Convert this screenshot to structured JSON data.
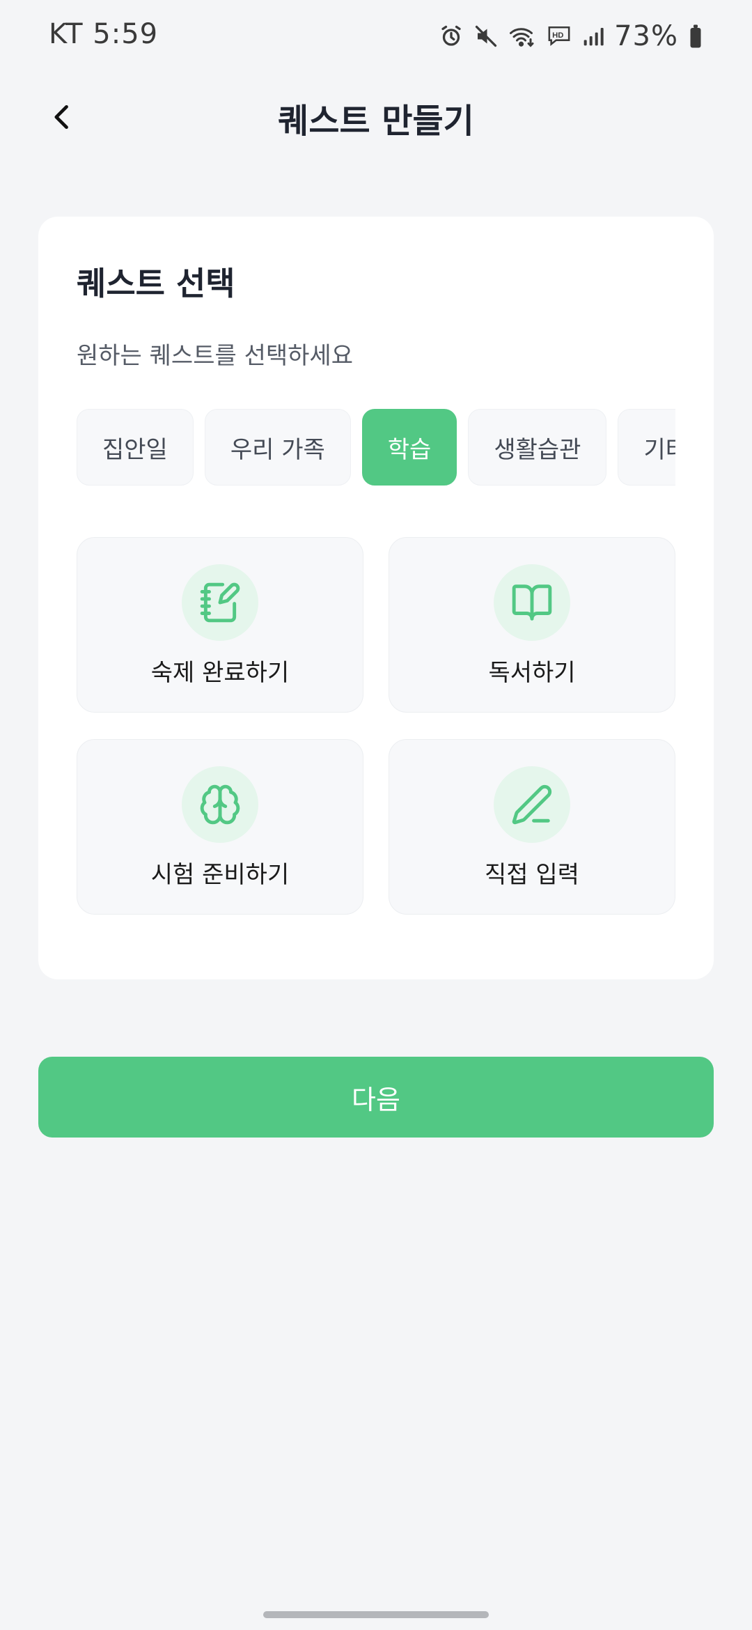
{
  "status_bar": {
    "carrier_time": "KT 5:59",
    "battery_percent": "73%",
    "icons": [
      "alarm-icon",
      "mute-icon",
      "wifi-icon",
      "hd-voice-icon",
      "signal-icon",
      "battery-icon"
    ]
  },
  "header": {
    "back_icon": "chevron-left-icon",
    "title": "퀘스트 만들기"
  },
  "card": {
    "title": "퀘스트 선택",
    "subtitle": "원하는 퀘스트를 선택하세요",
    "categories": [
      {
        "label": "집안일",
        "active": false
      },
      {
        "label": "우리 가족",
        "active": false
      },
      {
        "label": "학습",
        "active": true
      },
      {
        "label": "생활습관",
        "active": false
      },
      {
        "label": "기타",
        "active": false
      }
    ],
    "quests": [
      {
        "label": "숙제 완료하기",
        "icon": "notebook-pen-icon"
      },
      {
        "label": "독서하기",
        "icon": "book-open-icon"
      },
      {
        "label": "시험 준비하기",
        "icon": "brain-icon"
      },
      {
        "label": "직접 입력",
        "icon": "pencil-icon"
      }
    ]
  },
  "next_button": {
    "label": "다음"
  },
  "colors": {
    "accent": "#52c884",
    "icon_bg": "#e5f6ec",
    "background": "#f4f5f7",
    "card": "#ffffff"
  }
}
